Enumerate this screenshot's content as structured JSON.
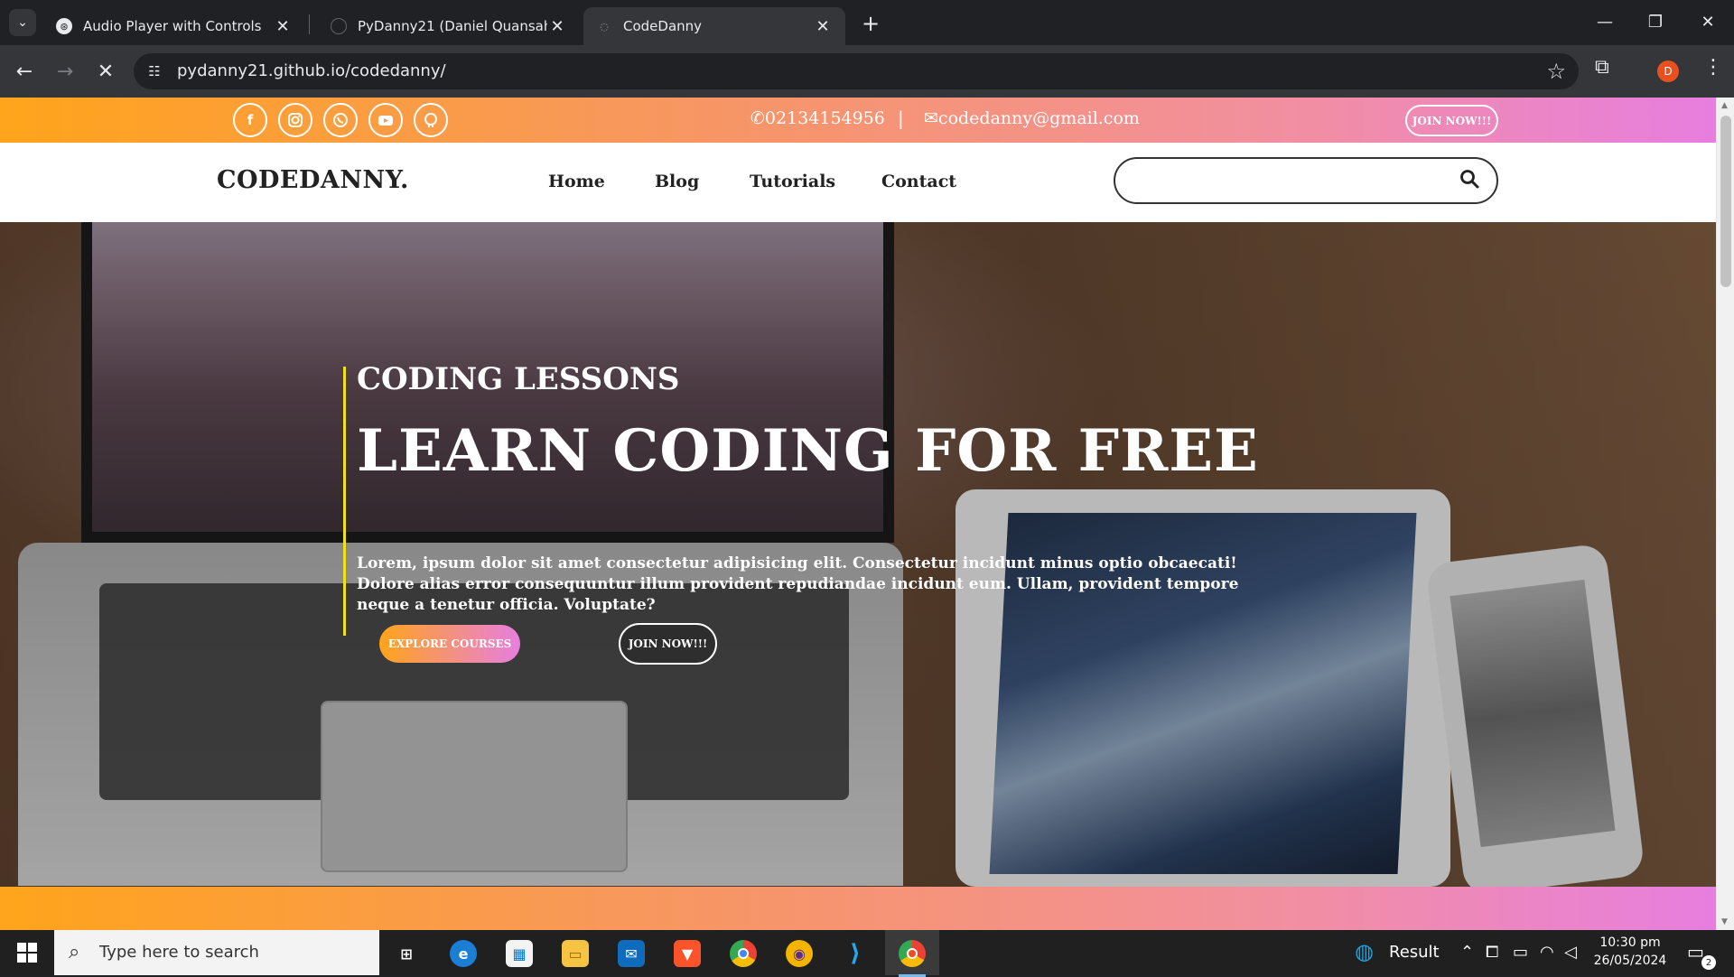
{
  "browser": {
    "tabs": [
      {
        "title": "Audio Player with Controls",
        "active": false
      },
      {
        "title": "PyDanny21 (Daniel Quansah)",
        "active": false
      },
      {
        "title": "CodeDanny",
        "active": true
      }
    ],
    "url": "pydanny21.github.io/codedanny/",
    "profile_initial": "D"
  },
  "site": {
    "topbar": {
      "social_icons": [
        "facebook-icon",
        "instagram-icon",
        "whatsapp-icon",
        "youtube-icon",
        "github-icon"
      ],
      "phone": "02134154956",
      "separator": "|",
      "email": "codedanny@gmail.com",
      "join_label": "JOIN NOW!!!"
    },
    "navbar": {
      "logo": "CODEDANNY.",
      "links": [
        "Home",
        "Blog",
        "Tutorials",
        "Contact"
      ],
      "search_placeholder": ""
    },
    "hero": {
      "subtitle": "CODING LESSONS",
      "title": "LEARN CODING FOR FREE",
      "text": "Lorem, ipsum dolor sit amet consectetur adipisicing elit. Consectetur incidunt minus optio obcaecati! Dolore alias error consequuntur illum provident repudiandae incidunt eum. Ullam, provident tempore neque a tenetur officia. Voluptate?",
      "explore_label": "EXPLORE COURSES",
      "join_label": "JOIN NOW!!!"
    },
    "colors": {
      "gradient_start": "#ffa41b",
      "gradient_end": "#e77ee0",
      "accent_bar": "#f3e01a"
    }
  },
  "taskbar": {
    "search_placeholder": "Type here to search",
    "weather_label": "Result",
    "time": "10:30 pm",
    "date": "26/05/2024",
    "notification_count": "2"
  }
}
